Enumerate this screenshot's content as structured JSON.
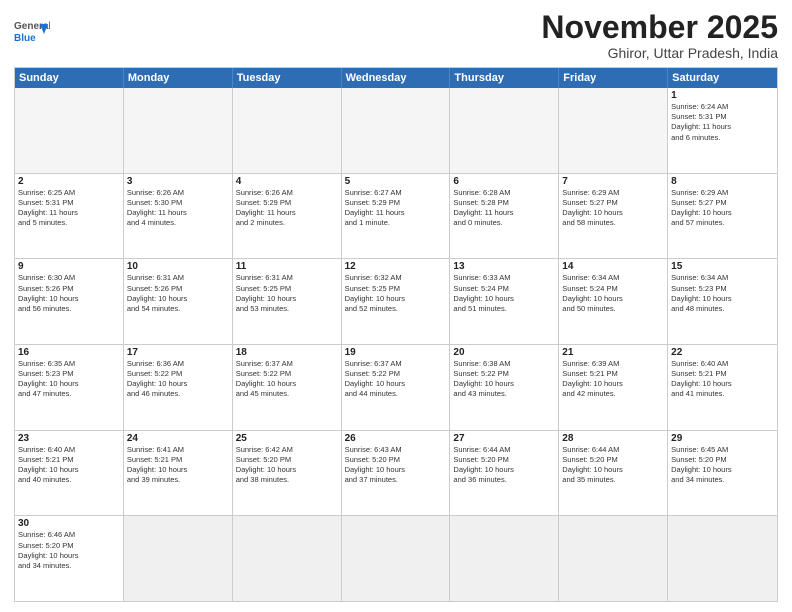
{
  "logo": {
    "general": "General",
    "blue": "Blue"
  },
  "title": "November 2025",
  "location": "Ghiror, Uttar Pradesh, India",
  "header_days": [
    "Sunday",
    "Monday",
    "Tuesday",
    "Wednesday",
    "Thursday",
    "Friday",
    "Saturday"
  ],
  "weeks": [
    [
      {
        "day": "",
        "info": ""
      },
      {
        "day": "",
        "info": ""
      },
      {
        "day": "",
        "info": ""
      },
      {
        "day": "",
        "info": ""
      },
      {
        "day": "",
        "info": ""
      },
      {
        "day": "",
        "info": ""
      },
      {
        "day": "1",
        "info": "Sunrise: 6:24 AM\nSunset: 5:31 PM\nDaylight: 11 hours\nand 6 minutes."
      }
    ],
    [
      {
        "day": "2",
        "info": "Sunrise: 6:25 AM\nSunset: 5:31 PM\nDaylight: 11 hours\nand 5 minutes."
      },
      {
        "day": "3",
        "info": "Sunrise: 6:26 AM\nSunset: 5:30 PM\nDaylight: 11 hours\nand 4 minutes."
      },
      {
        "day": "4",
        "info": "Sunrise: 6:26 AM\nSunset: 5:29 PM\nDaylight: 11 hours\nand 2 minutes."
      },
      {
        "day": "5",
        "info": "Sunrise: 6:27 AM\nSunset: 5:29 PM\nDaylight: 11 hours\nand 1 minute."
      },
      {
        "day": "6",
        "info": "Sunrise: 6:28 AM\nSunset: 5:28 PM\nDaylight: 11 hours\nand 0 minutes."
      },
      {
        "day": "7",
        "info": "Sunrise: 6:29 AM\nSunset: 5:27 PM\nDaylight: 10 hours\nand 58 minutes."
      },
      {
        "day": "8",
        "info": "Sunrise: 6:29 AM\nSunset: 5:27 PM\nDaylight: 10 hours\nand 57 minutes."
      }
    ],
    [
      {
        "day": "9",
        "info": "Sunrise: 6:30 AM\nSunset: 5:26 PM\nDaylight: 10 hours\nand 56 minutes."
      },
      {
        "day": "10",
        "info": "Sunrise: 6:31 AM\nSunset: 5:26 PM\nDaylight: 10 hours\nand 54 minutes."
      },
      {
        "day": "11",
        "info": "Sunrise: 6:31 AM\nSunset: 5:25 PM\nDaylight: 10 hours\nand 53 minutes."
      },
      {
        "day": "12",
        "info": "Sunrise: 6:32 AM\nSunset: 5:25 PM\nDaylight: 10 hours\nand 52 minutes."
      },
      {
        "day": "13",
        "info": "Sunrise: 6:33 AM\nSunset: 5:24 PM\nDaylight: 10 hours\nand 51 minutes."
      },
      {
        "day": "14",
        "info": "Sunrise: 6:34 AM\nSunset: 5:24 PM\nDaylight: 10 hours\nand 50 minutes."
      },
      {
        "day": "15",
        "info": "Sunrise: 6:34 AM\nSunset: 5:23 PM\nDaylight: 10 hours\nand 48 minutes."
      }
    ],
    [
      {
        "day": "16",
        "info": "Sunrise: 6:35 AM\nSunset: 5:23 PM\nDaylight: 10 hours\nand 47 minutes."
      },
      {
        "day": "17",
        "info": "Sunrise: 6:36 AM\nSunset: 5:22 PM\nDaylight: 10 hours\nand 46 minutes."
      },
      {
        "day": "18",
        "info": "Sunrise: 6:37 AM\nSunset: 5:22 PM\nDaylight: 10 hours\nand 45 minutes."
      },
      {
        "day": "19",
        "info": "Sunrise: 6:37 AM\nSunset: 5:22 PM\nDaylight: 10 hours\nand 44 minutes."
      },
      {
        "day": "20",
        "info": "Sunrise: 6:38 AM\nSunset: 5:22 PM\nDaylight: 10 hours\nand 43 minutes."
      },
      {
        "day": "21",
        "info": "Sunrise: 6:39 AM\nSunset: 5:21 PM\nDaylight: 10 hours\nand 42 minutes."
      },
      {
        "day": "22",
        "info": "Sunrise: 6:40 AM\nSunset: 5:21 PM\nDaylight: 10 hours\nand 41 minutes."
      }
    ],
    [
      {
        "day": "23",
        "info": "Sunrise: 6:40 AM\nSunset: 5:21 PM\nDaylight: 10 hours\nand 40 minutes."
      },
      {
        "day": "24",
        "info": "Sunrise: 6:41 AM\nSunset: 5:21 PM\nDaylight: 10 hours\nand 39 minutes."
      },
      {
        "day": "25",
        "info": "Sunrise: 6:42 AM\nSunset: 5:20 PM\nDaylight: 10 hours\nand 38 minutes."
      },
      {
        "day": "26",
        "info": "Sunrise: 6:43 AM\nSunset: 5:20 PM\nDaylight: 10 hours\nand 37 minutes."
      },
      {
        "day": "27",
        "info": "Sunrise: 6:44 AM\nSunset: 5:20 PM\nDaylight: 10 hours\nand 36 minutes."
      },
      {
        "day": "28",
        "info": "Sunrise: 6:44 AM\nSunset: 5:20 PM\nDaylight: 10 hours\nand 35 minutes."
      },
      {
        "day": "29",
        "info": "Sunrise: 6:45 AM\nSunset: 5:20 PM\nDaylight: 10 hours\nand 34 minutes."
      }
    ],
    [
      {
        "day": "30",
        "info": "Sunrise: 6:46 AM\nSunset: 5:20 PM\nDaylight: 10 hours\nand 34 minutes."
      },
      {
        "day": "",
        "info": ""
      },
      {
        "day": "",
        "info": ""
      },
      {
        "day": "",
        "info": ""
      },
      {
        "day": "",
        "info": ""
      },
      {
        "day": "",
        "info": ""
      },
      {
        "day": "",
        "info": ""
      }
    ]
  ]
}
